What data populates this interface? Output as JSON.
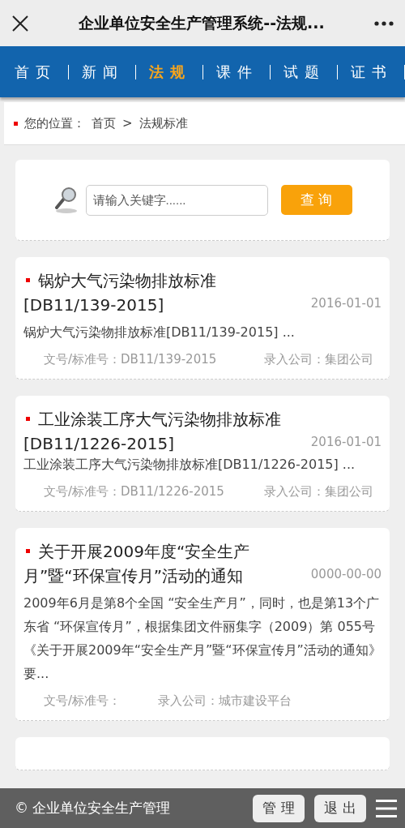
{
  "window": {
    "title": "企业单位安全生产管理系统--法规..."
  },
  "nav": [
    {
      "label": "首页",
      "selected": false
    },
    {
      "label": "新闻",
      "selected": false
    },
    {
      "label": "法规",
      "selected": true
    },
    {
      "label": "课件",
      "selected": false
    },
    {
      "label": "试题",
      "selected": false
    },
    {
      "label": "证书",
      "selected": false
    }
  ],
  "breadcrumb": {
    "label": "您的位置：",
    "items": [
      "首页",
      ">",
      "法规标准"
    ]
  },
  "search": {
    "placeholder": "请输入关键字......",
    "button": "查 询"
  },
  "articles": [
    {
      "title": "锅炉大气污染物排放标准[DB11/139-2015]",
      "date": "2016-01-01",
      "summary": "锅炉大气污染物排放标准[DB11/139-2015] ...",
      "doc_no_label": "文号/标准号：",
      "doc_no": "DB11/139-2015",
      "company_label": "录入公司：",
      "company": "集团公司"
    },
    {
      "title": "工业涂装工序大气污染物排放标准[DB11/1226-2015]",
      "date": "2016-01-01",
      "summary": "工业涂装工序大气污染物排放标准[DB11/1226-2015] ...",
      "doc_no_label": "文号/标准号：",
      "doc_no": "DB11/1226-2015",
      "company_label": "录入公司：",
      "company": "集团公司"
    },
    {
      "title": "关于开展2009年度“安全生产月”暨“环保宣传月”活动的通知",
      "date": "0000-00-00",
      "summary": "2009年6月是第8个全国 “安全生产月”，同时，也是第13个广东省 “环保宣传月”，根据集团文件丽集字（2009）第 055号《关于开展2009年“安全生产月”暨“环保宣传月”活动的通知》要...",
      "doc_no_label": "文号/标准号：",
      "company_label": "录入公司：",
      "company": "城市建设平台"
    }
  ],
  "footer": {
    "copyright": "© 企业单位安全生产管理",
    "buttons": [
      "管 理",
      "退 出"
    ]
  }
}
